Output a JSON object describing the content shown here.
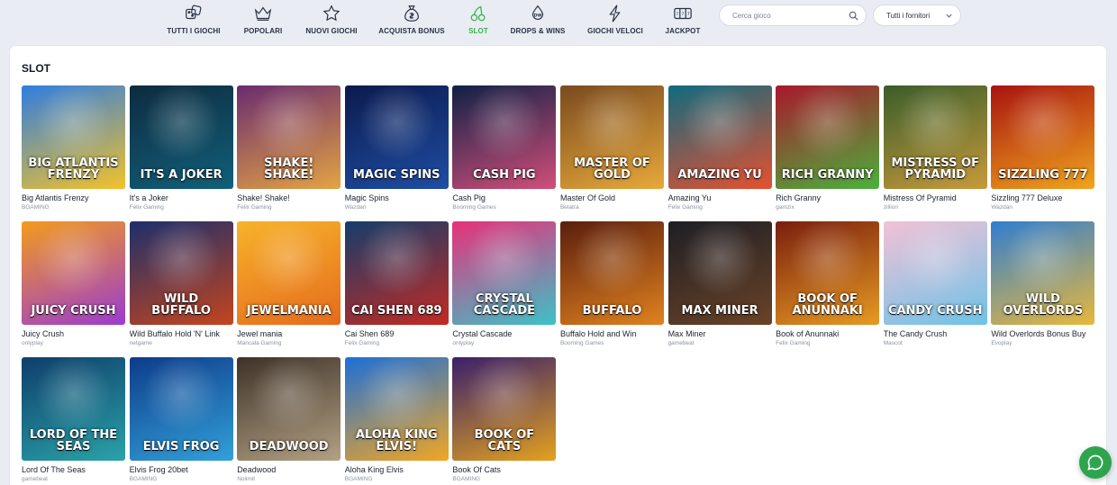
{
  "nav": {
    "items": [
      {
        "label": "TUTTI I GIOCHI",
        "icon": "dice-icon"
      },
      {
        "label": "POPOLARI",
        "icon": "crown-icon"
      },
      {
        "label": "NUOVI GIOCHI",
        "icon": "star-icon"
      },
      {
        "label": "ACQUISTA BONUS",
        "icon": "money-bag-icon"
      },
      {
        "label": "SLOT",
        "icon": "cherries-icon",
        "active": true
      },
      {
        "label": "DROPS & WINS",
        "icon": "drops-wins-icon"
      },
      {
        "label": "GIOCHI VELOCI",
        "icon": "lightning-icon"
      },
      {
        "label": "JACKPOT",
        "icon": "jackpot-icon"
      }
    ],
    "search_placeholder": "Cerca gioco",
    "providers_label": "Tutti i fornitori"
  },
  "section": {
    "title": "SLOT"
  },
  "colors": {
    "accent": "#39b34a",
    "chat": "#2ea44f"
  },
  "games": [
    {
      "name": "Big Atlantis Frenzy",
      "provider": "BGAMING",
      "logo": "BIG ATLANTIS FRENZY",
      "bg": [
        "#2f7de0",
        "#f3c22a"
      ]
    },
    {
      "name": "It's a Joker",
      "provider": "Felix Gaming",
      "logo": "IT'S A JOKER",
      "bg": [
        "#0e2b3f",
        "#11607a"
      ]
    },
    {
      "name": "Shake! Shake!",
      "provider": "Felix Gaming",
      "logo": "SHAKE! SHAKE!",
      "bg": [
        "#6a2b6f",
        "#e4a443"
      ]
    },
    {
      "name": "Magic Spins",
      "provider": "Wazdan",
      "logo": "MAGIC SPINS",
      "bg": [
        "#0b1a4d",
        "#1f4ea4"
      ]
    },
    {
      "name": "Cash Pig",
      "provider": "Booming Games",
      "logo": "CASH PIG",
      "bg": [
        "#102045",
        "#d24f7a"
      ]
    },
    {
      "name": "Master Of Gold",
      "provider": "Belatra",
      "logo": "MASTER OF GOLD",
      "bg": [
        "#7a4a1f",
        "#e8a93a"
      ]
    },
    {
      "name": "Amazing Yu",
      "provider": "Felix Gaming",
      "logo": "AMAZING YU",
      "bg": [
        "#0f6b7f",
        "#e7502f"
      ]
    },
    {
      "name": "Rich Granny",
      "provider": "gamzix",
      "logo": "RICH GRANNY",
      "bg": [
        "#a8182c",
        "#4bb13c"
      ]
    },
    {
      "name": "Mistress Of Pyramid",
      "provider": "zillion",
      "logo": "MISTRESS OF PYRAMID",
      "bg": [
        "#3a5d2a",
        "#c79a3b"
      ]
    },
    {
      "name": "Sizzling 777 Deluxe",
      "provider": "Wazdan",
      "logo": "SIZZLING 777",
      "bg": [
        "#a8130f",
        "#f0a51e"
      ]
    },
    {
      "name": "Juicy Crush",
      "provider": "onlyplay",
      "logo": "JUICY CRUSH",
      "bg": [
        "#f39b1c",
        "#9b3bd1"
      ]
    },
    {
      "name": "Wild Buffalo Hold 'N' Link",
      "provider": "netgame",
      "logo": "WILD BUFFALO",
      "bg": [
        "#1c2f6b",
        "#c5451e"
      ]
    },
    {
      "name": "Jewel mania",
      "provider": "Mancala Gaming",
      "logo": "JEWELMANIA",
      "bg": [
        "#f7b32b",
        "#e56b1d"
      ]
    },
    {
      "name": "Cai Shen 689",
      "provider": "Felix Gaming",
      "logo": "CAI SHEN 689",
      "bg": [
        "#143d6b",
        "#c42a22"
      ]
    },
    {
      "name": "Crystal Cascade",
      "provider": "onlyplay",
      "logo": "CRYSTAL CASCADE",
      "bg": [
        "#e8307a",
        "#3cc2c8"
      ]
    },
    {
      "name": "Buffalo Hold and Win",
      "provider": "Booming Games",
      "logo": "BUFFALO",
      "bg": [
        "#5a1e0d",
        "#e1821f"
      ]
    },
    {
      "name": "Max Miner",
      "provider": "gamebeat",
      "logo": "MAX MINER",
      "bg": [
        "#1e1e25",
        "#6a4326"
      ]
    },
    {
      "name": "Book of Anunnaki",
      "provider": "Felix Gaming",
      "logo": "BOOK OF ANUNNAKI",
      "bg": [
        "#7a1e0e",
        "#e79a23"
      ]
    },
    {
      "name": "The Candy Crush",
      "provider": "Mascot",
      "logo": "CANDY CRUSH",
      "bg": [
        "#f3c1d6",
        "#6dc3e8"
      ]
    },
    {
      "name": "Wild Overlords Bonus Buy",
      "provider": "Evoplay",
      "logo": "WILD OVERLORDS",
      "bg": [
        "#2f7ed0",
        "#e9b83c"
      ]
    },
    {
      "name": "Lord Of The Seas",
      "provider": "gamebeat",
      "logo": "LORD OF THE SEAS",
      "bg": [
        "#0e3e6b",
        "#2aa3a8"
      ]
    },
    {
      "name": "Elvis Frog 20bet",
      "provider": "BGAMING",
      "logo": "ELVIS FROG",
      "bg": [
        "#0d3c8a",
        "#33a0d9"
      ]
    },
    {
      "name": "Deadwood",
      "provider": "Nolimit",
      "logo": "DEADWOOD",
      "bg": [
        "#3d3228",
        "#b4a184"
      ]
    },
    {
      "name": "Aloha King Elvis",
      "provider": "BGAMING",
      "logo": "ALOHA KING ELVIS!",
      "bg": [
        "#1c6fd8",
        "#f2a623"
      ]
    },
    {
      "name": "Book Of Cats",
      "provider": "BGAMING",
      "logo": "BOOK OF CATS",
      "bg": [
        "#3a1f6b",
        "#e3a21f"
      ]
    }
  ]
}
